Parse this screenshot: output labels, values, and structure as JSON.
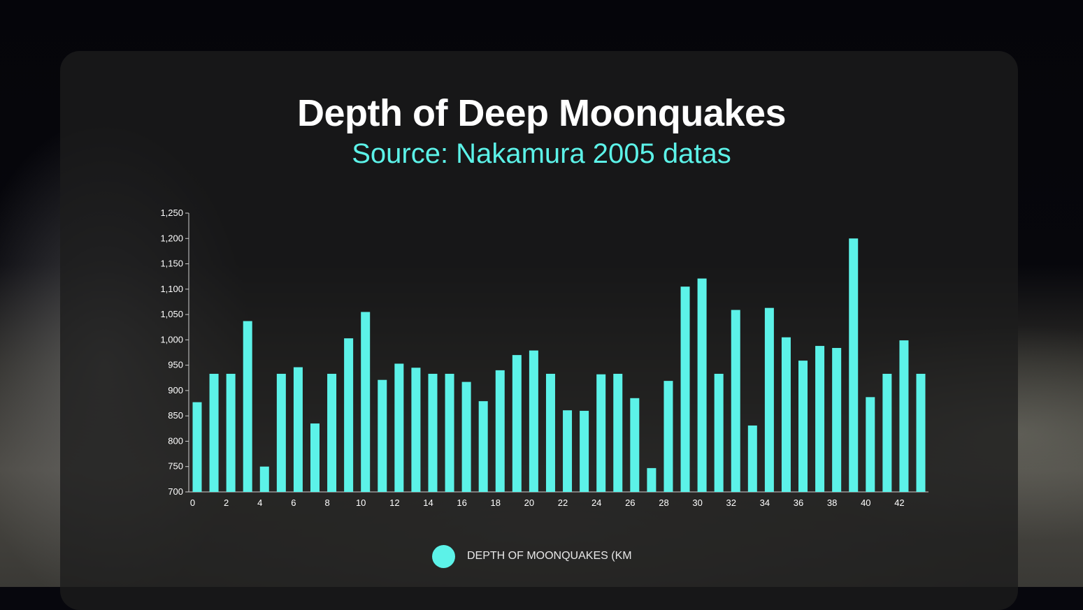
{
  "title": "Depth of Deep Moonquakes",
  "subtitle": "Source: Nakamura 2005 datas",
  "colors": {
    "bar": "#5cf2e8",
    "subtitle": "#5cf2e8",
    "title": "#ffffff"
  },
  "chart_data": {
    "type": "bar",
    "title": "Depth of Deep Moonquakes",
    "subtitle": "Source: Nakamura 2005 datas",
    "xlabel": "",
    "ylabel": "",
    "ylim": [
      700,
      1250
    ],
    "y_ticks": [
      700,
      750,
      800,
      850,
      900,
      950,
      1000,
      1050,
      1100,
      1150,
      1200,
      1250
    ],
    "y_tick_labels": [
      "700",
      "750",
      "800",
      "850",
      "900",
      "950",
      "1,000",
      "1,050",
      "1,100",
      "1,150",
      "1,200",
      "1,250"
    ],
    "x_tick_labels": [
      "0",
      "2",
      "4",
      "6",
      "8",
      "10",
      "12",
      "14",
      "16",
      "18",
      "20",
      "22",
      "24",
      "26",
      "28",
      "30",
      "32",
      "34",
      "36",
      "38",
      "40",
      "42"
    ],
    "x": [
      0,
      1,
      2,
      3,
      4,
      5,
      6,
      7,
      8,
      9,
      10,
      11,
      12,
      13,
      14,
      15,
      16,
      17,
      18,
      19,
      20,
      21,
      22,
      23,
      24,
      25,
      26,
      27,
      28,
      29,
      30,
      31,
      32,
      33,
      34,
      35,
      36,
      37,
      38,
      39,
      40,
      41,
      42,
      43
    ],
    "series": [
      {
        "name": "DEPTH OF MOONQUAKES (KM",
        "values": [
          877,
          933,
          933,
          1037,
          750,
          933,
          946,
          835,
          933,
          1003,
          1055,
          921,
          953,
          945,
          933,
          933,
          917,
          879,
          940,
          970,
          979,
          933,
          861,
          860,
          932,
          933,
          885,
          747,
          919,
          1105,
          1121,
          933,
          1059,
          831,
          1063,
          1005,
          959,
          988,
          984,
          1200,
          887,
          933,
          999,
          933
        ]
      }
    ],
    "grid": false,
    "legend": "bottom-center"
  }
}
